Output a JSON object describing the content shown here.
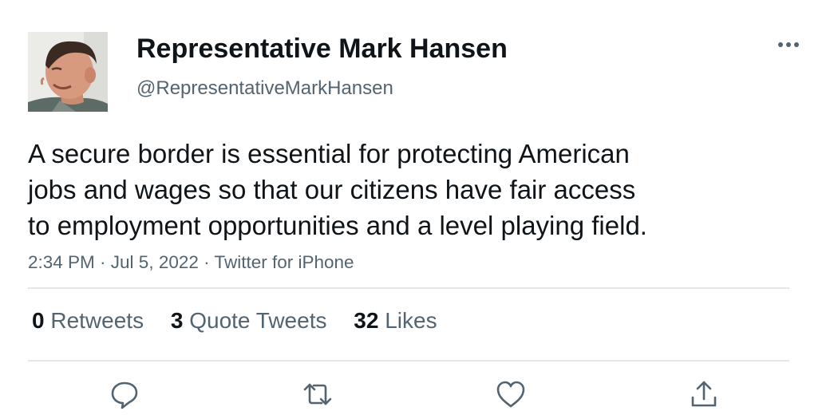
{
  "author": {
    "display_name": "Representative Mark Hansen",
    "handle": "@RepresentativeMarkHansen"
  },
  "tweet": {
    "lines": [
      "A secure border is essential for protecting American",
      "jobs and wages so that our citizens have fair access",
      "to employment opportunities and a level playing field."
    ],
    "meta": "2:34 PM · Jul 5, 2022 · Twitter for iPhone"
  },
  "stats": {
    "retweets_count": "0",
    "retweets_label": "Retweets",
    "quotes_count": "3",
    "quotes_label": "Quote Tweets",
    "likes_count": "32",
    "likes_label": "Likes"
  },
  "icons": {
    "more": "more-horizontal-icon",
    "reply": "reply-icon",
    "retweet": "retweet-icon",
    "like": "heart-icon",
    "share": "share-icon"
  },
  "colors": {
    "text_primary": "#0f1419",
    "text_secondary": "#536471",
    "divider": "#e6e6e6"
  }
}
